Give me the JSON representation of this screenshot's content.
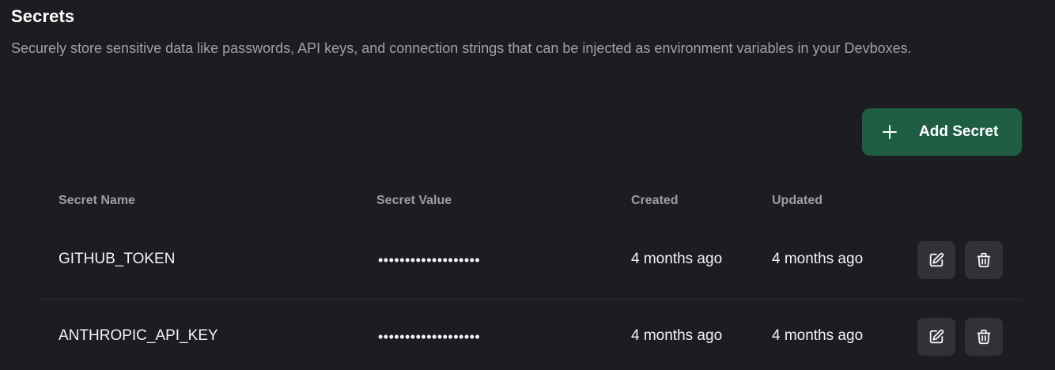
{
  "header": {
    "title": "Secrets",
    "description": "Securely store sensitive data like passwords, API keys, and connection strings that can be injected as environment variables in your Devboxes."
  },
  "actions": {
    "add_label": "Add Secret",
    "add_icon": "plus-icon"
  },
  "colors": {
    "background": "#1c1d21",
    "accent": "#1f5e45",
    "icon_button_bg": "#313238"
  },
  "table": {
    "columns": [
      "Secret Name",
      "Secret Value",
      "Created",
      "Updated"
    ],
    "rows": [
      {
        "name": "GITHUB_TOKEN",
        "value": "•••••••••••••••••••",
        "created": "4 months ago",
        "updated": "4 months ago",
        "edit_icon": "edit-icon",
        "delete_icon": "trash-icon"
      },
      {
        "name": "ANTHROPIC_API_KEY",
        "value": "•••••••••••••••••••",
        "created": "4 months ago",
        "updated": "4 months ago",
        "edit_icon": "edit-icon",
        "delete_icon": "trash-icon"
      }
    ]
  }
}
